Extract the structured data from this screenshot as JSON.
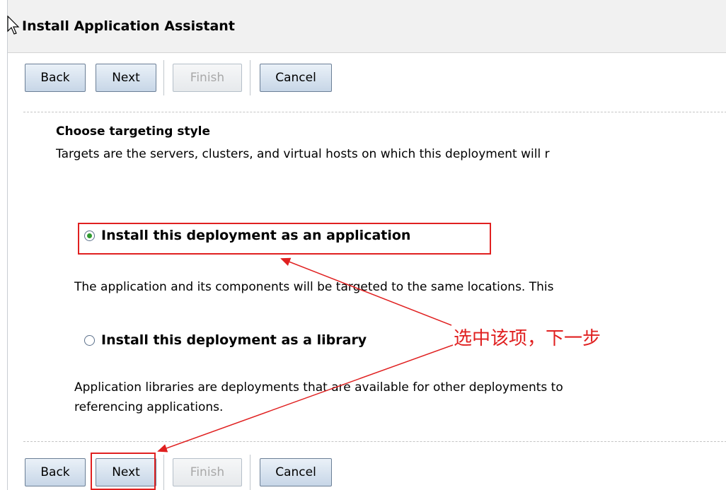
{
  "window": {
    "title": "Install Application Assistant"
  },
  "toolbar_top": {
    "back_label": "Back",
    "next_label": "Next",
    "finish_label": "Finish",
    "cancel_label": "Cancel"
  },
  "toolbar_bottom": {
    "back_label": "Back",
    "next_label": "Next",
    "finish_label": "Finish",
    "cancel_label": "Cancel"
  },
  "section": {
    "heading": "Choose targeting style",
    "description": "Targets are the servers, clusters, and virtual hosts on which this deployment will r"
  },
  "options": [
    {
      "label": "Install this deployment as an application",
      "selected": true,
      "description": "The application and its components will be targeted to the same locations. This"
    },
    {
      "label": "Install this deployment as a library",
      "selected": false,
      "description": "Application libraries are deployments that are available for other deployments to",
      "description_line2": "referencing applications."
    }
  ],
  "annotation": {
    "text": "选中该项，下一步",
    "color": "#e02020"
  },
  "colors": {
    "button_border": "#6b7f96",
    "button_fill": "#c7d6e7",
    "annotation_red": "#e02020",
    "radio_selected": "#2f9a2f"
  }
}
